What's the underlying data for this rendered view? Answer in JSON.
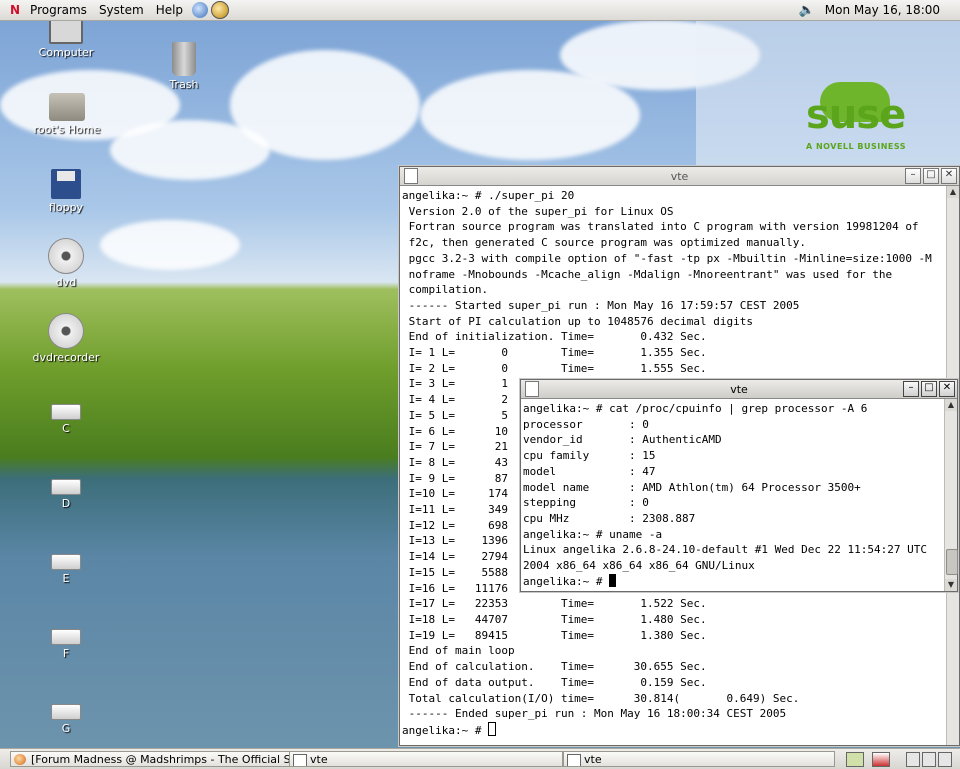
{
  "top_panel": {
    "menu": [
      "Programs",
      "System",
      "Help"
    ],
    "clock": "Mon May 16, 18:00"
  },
  "desktop": {
    "icons": [
      {
        "label": "Computer",
        "icon": "computer-icon"
      },
      {
        "label": "Trash",
        "icon": "trash-icon"
      },
      {
        "label": "root's Home",
        "icon": "home-folder-icon"
      },
      {
        "label": "floppy",
        "icon": "floppy-icon"
      },
      {
        "label": "dvd",
        "icon": "disc-icon"
      },
      {
        "label": "dvdrecorder",
        "icon": "disc-icon"
      },
      {
        "label": "C",
        "icon": "drive-icon"
      },
      {
        "label": "D",
        "icon": "drive-icon"
      },
      {
        "label": "E",
        "icon": "drive-icon"
      },
      {
        "label": "F",
        "icon": "drive-icon"
      },
      {
        "label": "G",
        "icon": "drive-icon"
      }
    ],
    "brand": {
      "name": "suse",
      "tagline": "A NOVELL BUSINESS",
      "color": "#5aa51b"
    }
  },
  "terminal_back": {
    "title": "vte",
    "lines": [
      "angelika:~ # ./super_pi 20",
      " Version 2.0 of the super_pi for Linux OS",
      " Fortran source program was translated into C program with version 19981204 of",
      " f2c, then generated C source program was optimized manually.",
      " pgcc 3.2-3 with compile option of \"-fast -tp px -Mbuiltin -Minline=size:1000 -M",
      " noframe -Mnobounds -Mcache_align -Mdalign -Mnoreentrant\" was used for the",
      " compilation.",
      " ------ Started super_pi run : Mon May 16 17:59:57 CEST 2005",
      " Start of PI calculation up to 1048576 decimal digits",
      " End of initialization. Time=       0.432 Sec.",
      " I= 1 L=       0        Time=       1.355 Sec.",
      " I= 2 L=       0        Time=       1.555 Sec.",
      " I= 3 L=       1",
      " I= 4 L=       2",
      " I= 5 L=       5",
      " I= 6 L=      10",
      " I= 7 L=      21",
      " I= 8 L=      43",
      " I= 9 L=      87",
      " I=10 L=     174",
      " I=11 L=     349",
      " I=12 L=     698",
      " I=13 L=    1396",
      " I=14 L=    2794",
      " I=15 L=    5588",
      " I=16 L=   11176",
      " I=17 L=   22353        Time=       1.522 Sec.",
      " I=18 L=   44707        Time=       1.480 Sec.",
      " I=19 L=   89415        Time=       1.380 Sec.",
      " End of main loop",
      " End of calculation.    Time=      30.655 Sec.",
      " End of data output.    Time=       0.159 Sec.",
      " Total calculation(I/O) time=      30.814(       0.649) Sec.",
      " ------ Ended super_pi run : Mon May 16 18:00:34 CEST 2005"
    ],
    "prompt": "angelika:~ # "
  },
  "terminal_front": {
    "title": "vte",
    "lines": [
      "angelika:~ # cat /proc/cpuinfo | grep processor -A 6",
      "processor       : 0",
      "vendor_id       : AuthenticAMD",
      "cpu family      : 15",
      "model           : 47",
      "model name      : AMD Athlon(tm) 64 Processor 3500+",
      "stepping        : 0",
      "cpu MHz         : 2308.887",
      "angelika:~ # uname -a",
      "Linux angelika 2.6.8-24.10-default #1 Wed Dec 22 11:54:27 UTC",
      "2004 x86_64 x86_64 x86_64 GNU/Linux"
    ],
    "prompt": "angelika:~ # "
  },
  "taskbar": {
    "items": [
      {
        "label": "[Forum Madness @ Madshrimps - The Official Super",
        "icon": "browser-icon"
      },
      {
        "label": "vte",
        "icon": "terminal-icon"
      },
      {
        "label": "vte",
        "icon": "terminal-icon"
      }
    ]
  }
}
